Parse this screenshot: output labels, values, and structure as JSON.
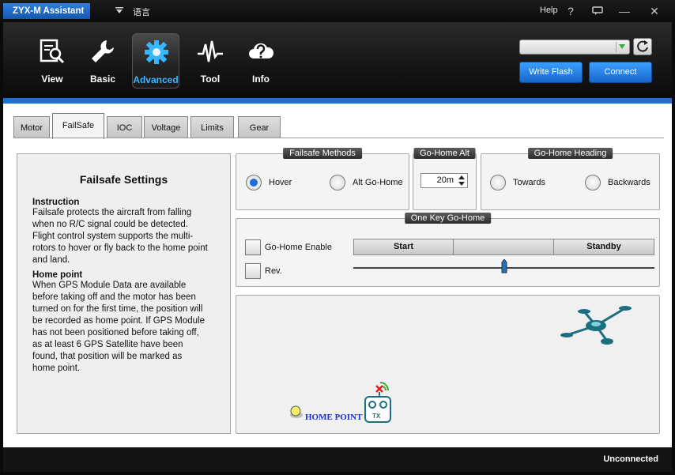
{
  "window": {
    "app_title": "ZYX-M Assistant",
    "language_label": "语言",
    "help_label": "Help"
  },
  "nav": [
    {
      "label": "View",
      "icon": "search-document-icon",
      "active": false
    },
    {
      "label": "Basic",
      "icon": "wrench-icon",
      "active": false
    },
    {
      "label": "Advanced",
      "icon": "gear-icon",
      "active": true
    },
    {
      "label": "Tool",
      "icon": "waveform-icon",
      "active": false
    },
    {
      "label": "Info",
      "icon": "info-cloud-icon",
      "active": false
    }
  ],
  "actions": {
    "flash_select_value": "",
    "write_flash_label": "Write Flash",
    "connect_label": "Connect"
  },
  "tabs": [
    {
      "label": "Motor",
      "active": false
    },
    {
      "label": "FailSafe",
      "active": true
    },
    {
      "label": "IOC",
      "active": false
    },
    {
      "label": "Voltage",
      "active": false
    },
    {
      "label": "Limits",
      "active": false
    },
    {
      "label": "Gear",
      "active": false
    }
  ],
  "info": {
    "title": "Failsafe Settings",
    "instruction_heading": "Instruction",
    "instruction_lines": [
      "Failsafe protects the aircraft from falling",
      "when no R/C signal could be detected.",
      "Flight control system supports the multi-",
      "rotors to hover or fly back to the home point",
      "and land."
    ],
    "home_heading": "Home point",
    "home_lines": [
      "When GPS Module Data are available",
      "before taking off and the motor has been",
      "turned on for the first time, the position will",
      "be recorded as home point. If GPS Module",
      "has not been positioned before taking off,",
      "as at least 6 GPS Satellite have been",
      "found, that position will be marked as",
      "home point."
    ]
  },
  "failsafe_methods": {
    "title": "Failsafe Methods",
    "options": [
      "Hover",
      "Alt Go-Home"
    ],
    "selected": "Hover"
  },
  "go_home_alt": {
    "title": "Go-Home Alt",
    "value": "20m"
  },
  "go_home_heading": {
    "title": "Go-Home Heading",
    "options": [
      "Towards",
      "Backwards"
    ],
    "selected": ""
  },
  "one_key": {
    "title": "One Key Go-Home",
    "enable_label": "Go-Home Enable",
    "enable_checked": false,
    "rev_label": "Rev.",
    "rev_checked": false,
    "segments": [
      "Start",
      "",
      "Standby"
    ],
    "slider_value": 0.5
  },
  "illustration": {
    "home_point_label": "HOME POINT",
    "tx_label": "TX"
  },
  "status": {
    "connection": "Unconnected"
  },
  "colors": {
    "accent": "#1f6fd4",
    "active_nav_label": "#36b7ff",
    "drone": "#1b6f80"
  }
}
